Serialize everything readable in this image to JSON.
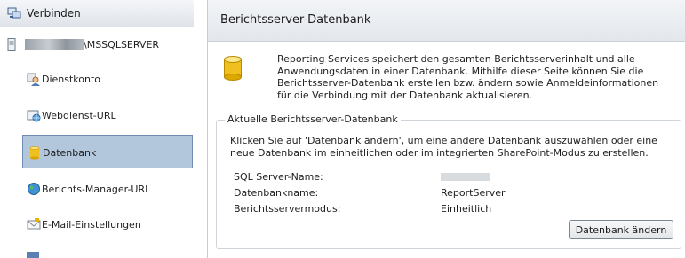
{
  "nav": {
    "header_label": "Verbinden",
    "header_icon": "connect-icon",
    "server_label": "\\MSSQLSERVER",
    "items": [
      {
        "label": "Dienstkonto",
        "icon": "service-account-icon"
      },
      {
        "label": "Webdienst-URL",
        "icon": "web-url-icon"
      },
      {
        "label": "Datenbank",
        "icon": "database-icon",
        "selected": true
      },
      {
        "label": "Berichts-Manager-URL",
        "icon": "globe-icon"
      },
      {
        "label": "E-Mail-Einstellungen",
        "icon": "email-icon"
      }
    ]
  },
  "main": {
    "title": "Berichtsserver-Datenbank",
    "intro": "Reporting Services speichert den gesamten Berichtsserverinhalt und alle Anwendungsdaten in einer Datenbank. Mithilfe dieser Seite können Sie die Berichtsserver-Datenbank erstellen bzw. ändern sowie Anmeldeinformationen für die Verbindung mit der Datenbank aktualisieren.",
    "group": {
      "legend": "Aktuelle Berichtsserver-Datenbank",
      "text": "Klicken Sie auf 'Datenbank ändern', um eine andere Datenbank auszuwählen oder eine neue Datenbank im einheitlichen oder im integrierten SharePoint-Modus zu erstellen.",
      "fields": [
        {
          "label": "SQL Server-Name:",
          "value": ""
        },
        {
          "label": "Datenbankname:",
          "value": "ReportServer"
        },
        {
          "label": "Berichtsservermodus:",
          "value": "Einheitlich"
        }
      ],
      "button": "Datenbank ändern"
    }
  },
  "colors": {
    "selection": "#b2c6dc",
    "selection_border": "#6e8db3",
    "db_icon": "#e8b400"
  }
}
